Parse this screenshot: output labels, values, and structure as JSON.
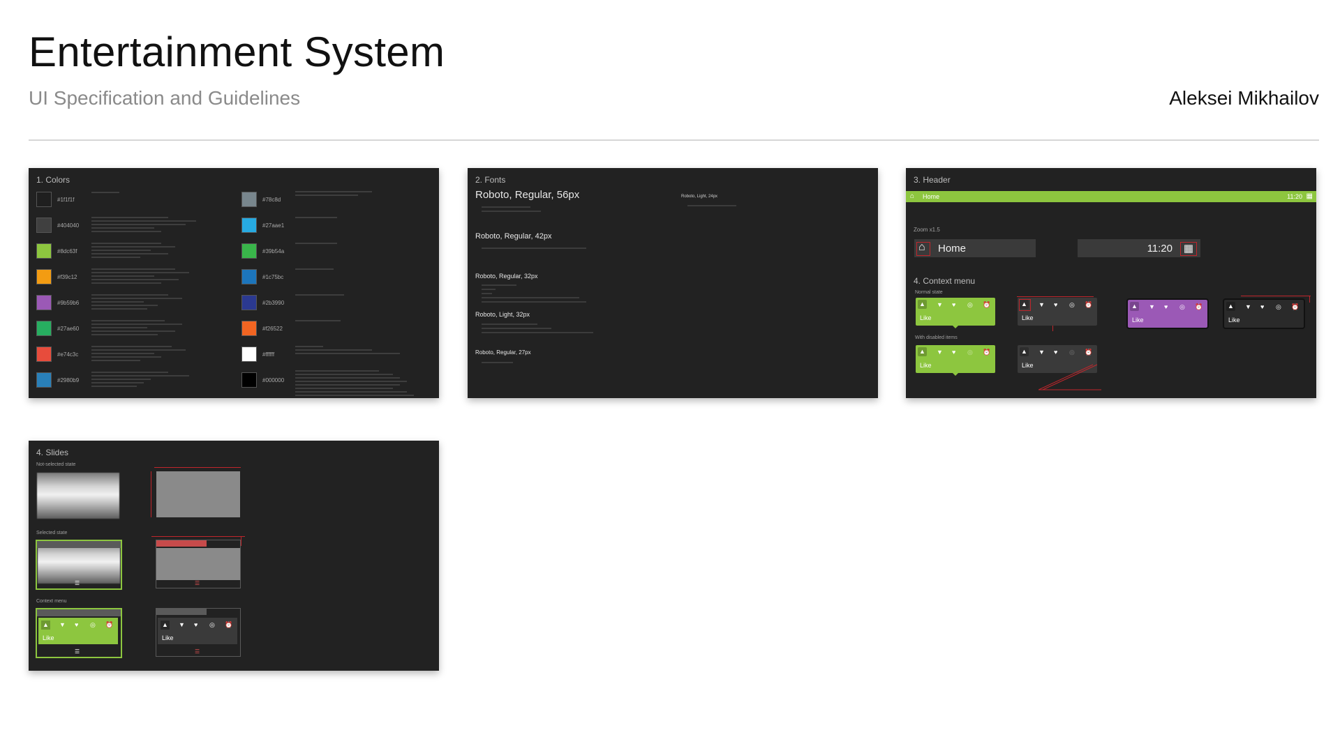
{
  "header": {
    "title": "Entertainment System",
    "subtitle": "UI Specification and Guidelines",
    "author": "Aleksei Mikhailov"
  },
  "colors_card": {
    "title": "1. Colors",
    "left_swatches": [
      {
        "hex": "#1f1f1f"
      },
      {
        "hex": "#404040"
      },
      {
        "hex": "#8dc63f"
      },
      {
        "hex": "#f39c12"
      },
      {
        "hex": "#9b59b6"
      },
      {
        "hex": "#27ae60"
      },
      {
        "hex": "#e74c3c"
      },
      {
        "hex": "#2980b9"
      }
    ],
    "right_swatches": [
      {
        "hex": "#78c8d"
      },
      {
        "hex": "#27aae1"
      },
      {
        "hex": "#39b54a"
      },
      {
        "hex": "#1c75bc"
      },
      {
        "hex": "#2b3990"
      },
      {
        "hex": "#f26522"
      },
      {
        "hex": "#ffffff"
      },
      {
        "hex": "#000000"
      }
    ]
  },
  "fonts_card": {
    "title": "2. Fonts",
    "samples": [
      "Roboto, Regular, 56px",
      "Roboto, Regular, 42px",
      "Roboto, Regular, 32px",
      "Roboto, Light, 32px",
      "Roboto, Regular, 27px"
    ],
    "side_sample": "Roboto, Light, 24px"
  },
  "header_card": {
    "title": "3. Header",
    "bar_label": "Home",
    "bar_time": "11:20",
    "zoom_label": "Zoom x1.5",
    "zoom_home": "Home",
    "zoom_time": "11:20",
    "context_title": "4. Context menu",
    "normal_state": "Normal state",
    "disabled_state": "With disabled items",
    "like": "Like"
  },
  "slides_card": {
    "title": "4. Slides",
    "not_selected": "Not-selected state",
    "selected": "Selected state",
    "context_menu": "Context menu",
    "like": "Like"
  },
  "colors": {
    "accent_green": "#8dc63f",
    "purple": "#9b59b6",
    "card_bg": "#222222",
    "red_mark": "#c0262c"
  }
}
